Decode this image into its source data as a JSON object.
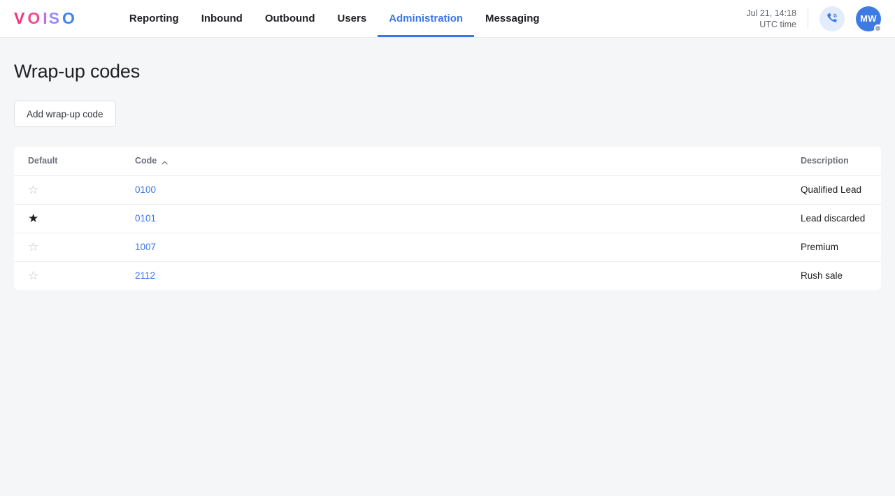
{
  "brand": {
    "name": "VOISO",
    "letters": [
      "V",
      "O",
      "I",
      "S",
      "O"
    ],
    "colors": [
      "#f5327a",
      "#ef4c8f",
      "#c86bdd",
      "#9a8cf3",
      "#3d86ee"
    ]
  },
  "nav": {
    "items": [
      {
        "label": "Reporting",
        "active": false
      },
      {
        "label": "Inbound",
        "active": false
      },
      {
        "label": "Outbound",
        "active": false
      },
      {
        "label": "Users",
        "active": false
      },
      {
        "label": "Administration",
        "active": true
      },
      {
        "label": "Messaging",
        "active": false
      }
    ],
    "active_color": "#3b76e8"
  },
  "header": {
    "datetime": "Jul 21, 14:18",
    "timezone": "UTC time",
    "phone_icon": "phone-call-icon",
    "avatar_initials": "MW",
    "avatar_color": "#3d7ae4",
    "status_color": "#a9adb4"
  },
  "page": {
    "title": "Wrap-up codes",
    "add_button_label": "Add wrap-up code"
  },
  "table": {
    "columns": [
      {
        "label": "Default",
        "sortable": false
      },
      {
        "label": "Code",
        "sortable": true,
        "sort": "asc",
        "sort_icon": "chevron-up-icon"
      },
      {
        "label": "Description",
        "sortable": false
      }
    ],
    "rows": [
      {
        "default": false,
        "code": "0100",
        "description": "Qualified Lead",
        "star_icon": "star-outline-icon"
      },
      {
        "default": true,
        "code": "0101",
        "description": "Lead discarded",
        "star_icon": "star-filled-icon"
      },
      {
        "default": false,
        "code": "1007",
        "description": "Premium",
        "star_icon": "star-outline-icon"
      },
      {
        "default": false,
        "code": "2112",
        "description": "Rush sale",
        "star_icon": "star-outline-icon"
      }
    ],
    "star_on_glyph": "★",
    "star_off_glyph": "☆",
    "link_color": "#3b76e8"
  }
}
